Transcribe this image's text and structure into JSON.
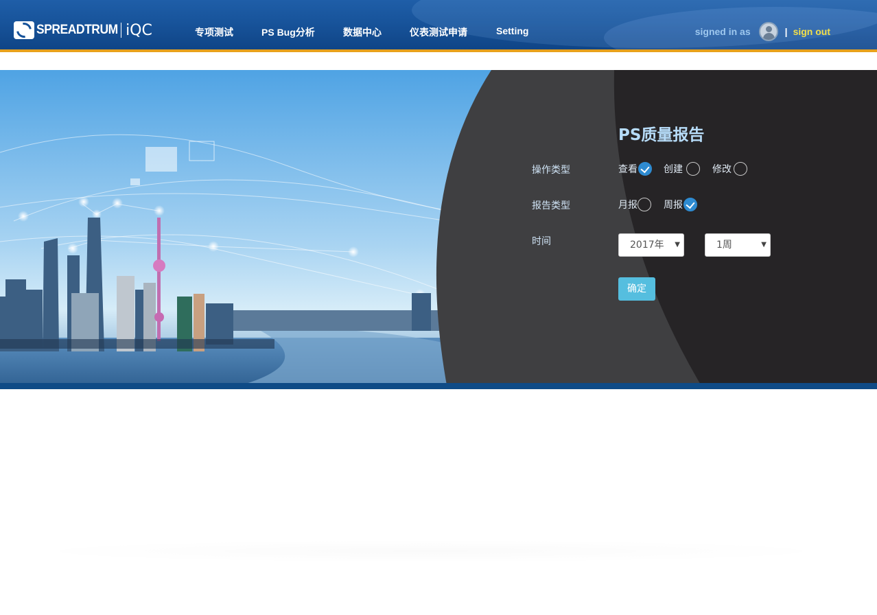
{
  "header": {
    "logo_word": "SPREADTRUM",
    "logo_suffix": "iQC",
    "nav": [
      "专项测试",
      "PS Bug分析",
      "数据中心",
      "仪表测试申请",
      "Setting"
    ],
    "signed_in_label": "signed in as",
    "separator": "|",
    "sign_out": "sign out"
  },
  "form": {
    "title": "PS质量报告",
    "operation_label": "操作类型",
    "operation_options": [
      {
        "label": "查看",
        "checked": true
      },
      {
        "label": "创建",
        "checked": false
      },
      {
        "label": "修改",
        "checked": false
      }
    ],
    "report_label": "报告类型",
    "report_options": [
      {
        "label": "月报",
        "checked": false
      },
      {
        "label": "周报",
        "checked": true
      }
    ],
    "time_label": "时间",
    "year_value": "2017年",
    "week_value": "1周",
    "submit_label": "确定"
  },
  "colors": {
    "header_blue": "#17539a",
    "accent_orange": "#e8a11c",
    "sign_out_yellow": "#f3e04a",
    "title_light_blue": "#b7dcf9",
    "check_blue": "#2e8bd1",
    "submit_cyan": "#55bedf"
  },
  "icons": {
    "avatar": "user-avatar-icon",
    "dropdown": "triangle-down-icon",
    "check": "check-icon"
  }
}
